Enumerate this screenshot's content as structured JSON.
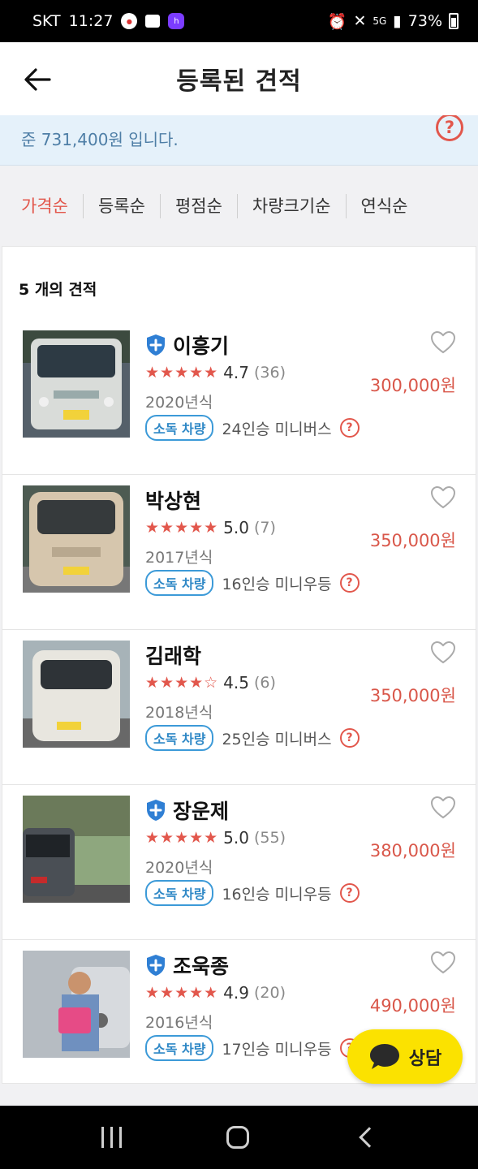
{
  "status_bar": {
    "carrier": "SKT",
    "time": "11:27",
    "network": "5G",
    "battery": "73%"
  },
  "header": {
    "title": "등록된 견적",
    "back_icon": "arrow-left-icon"
  },
  "notice": {
    "text": "준 731,400원 입니다."
  },
  "sort_options": [
    {
      "label": "가격순",
      "active": true
    },
    {
      "label": "등록순",
      "active": false
    },
    {
      "label": "평점순",
      "active": false
    },
    {
      "label": "차량크기순",
      "active": false
    },
    {
      "label": "연식순",
      "active": false
    }
  ],
  "list": {
    "count_label": "5 개의 견적",
    "items": [
      {
        "name": "이흥기",
        "verified": true,
        "rating_value": 4.7,
        "stars": "★★★★★",
        "score": "4.7",
        "reviews": "(36)",
        "year": "2020년식",
        "tag": "소독 차량",
        "vehicle": "24인승 미니버스",
        "price": "300,000원"
      },
      {
        "name": "박상현",
        "verified": false,
        "rating_value": 5.0,
        "stars": "★★★★★",
        "score": "5.0",
        "reviews": "(7)",
        "year": "2017년식",
        "tag": "소독 차량",
        "vehicle": "16인승 미니우등",
        "price": "350,000원"
      },
      {
        "name": "김래학",
        "verified": false,
        "rating_value": 4.5,
        "stars": "★★★★☆",
        "score": "4.5",
        "reviews": "(6)",
        "year": "2018년식",
        "tag": "소독 차량",
        "vehicle": "25인승 미니버스",
        "price": "350,000원"
      },
      {
        "name": "장운제",
        "verified": true,
        "rating_value": 5.0,
        "stars": "★★★★★",
        "score": "5.0",
        "reviews": "(55)",
        "year": "2020년식",
        "tag": "소독 차량",
        "vehicle": "16인승 미니우등",
        "price": "380,000원"
      },
      {
        "name": "조욱종",
        "verified": true,
        "rating_value": 4.9,
        "stars": "★★★★★",
        "score": "4.9",
        "reviews": "(20)",
        "year": "2016년식",
        "tag": "소독 차량",
        "vehicle": "17인승 미니우등",
        "price": "490,000원"
      }
    ]
  },
  "chat_button": {
    "label": "상담"
  },
  "colors": {
    "accent": "#e2574c",
    "tag_blue": "#3c9ad8",
    "chat_yellow": "#fbe200",
    "notice_bg": "#e5f1fa"
  }
}
